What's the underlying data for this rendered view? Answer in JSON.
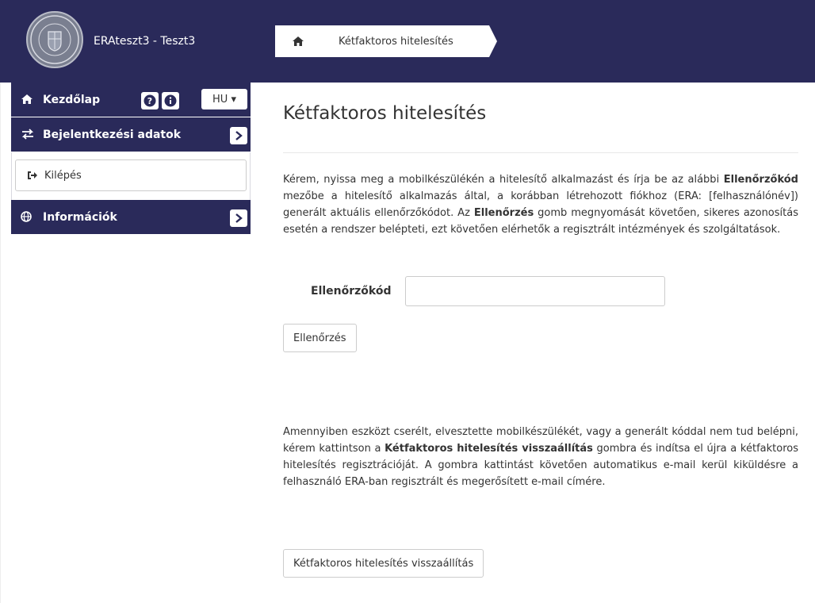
{
  "header": {
    "user_label": "ERAteszt3 - Teszt3",
    "breadcrumb_current": "Kétfaktoros hitelesítés"
  },
  "sidebar": {
    "home_label": "Kezdőlap",
    "language": "HU ▾",
    "login_section_label": "Bejelentkezési adatok",
    "logout_label": "Kilépés",
    "info_section_label": "Információk"
  },
  "main": {
    "title": "Kétfaktoros hitelesítés",
    "intro": {
      "part1": "Kérem, nyissa meg a mobilkészülékén a hitelesítő alkalmazást és írja be az alábbi ",
      "bold1": "Ellenőrzőkód",
      "part2": " mezőbe a hitelesítő alkalmazás által, a korábban létrehozott fiókhoz (ERA: [felhasználónév]) generált aktuális ellenőrzőkódot. Az ",
      "bold2": "Ellenőrzés",
      "part3": " gomb megnyomását követően, sikeres azonosítás esetén a rendszer belépteti, ezt követően elérhetők a regisztrált intézmények és szolgáltatások."
    },
    "code_label": "Ellenőrzőkód",
    "code_value": "",
    "verify_button": "Ellenőrzés",
    "reset_info": {
      "part1": "Amennyiben eszközt cserélt, elvesztette mobilkészülékét, vagy a generált kóddal nem tud belépni, kérem kattintson a ",
      "bold1": "Kétfaktoros hitelesítés visszaállítás",
      "part2": " gombra és indítsa el újra a kétfaktoros hitelesítés regisztrációját. A gombra kattintást követően automatikus e-mail kerül kiküldésre a felhasználó ERA-ban regisztrált és megerősített e-mail címére."
    },
    "reset_button": "Kétfaktoros hitelesítés visszaállítás"
  },
  "colors": {
    "navy": "#2a2a5a",
    "white": "#ffffff",
    "text": "#333333",
    "border": "#cccccc"
  }
}
